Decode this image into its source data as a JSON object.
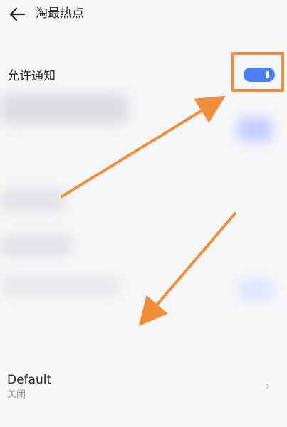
{
  "header": {
    "title": "淘最热点"
  },
  "notification": {
    "label": "允许通知",
    "enabled": true
  },
  "default": {
    "title": "Default",
    "status": "关闭"
  },
  "colors": {
    "accent": "#4f7df4",
    "highlight": "#f08e3b"
  },
  "icons": {
    "back": "back-arrow-icon",
    "chevron": "chevron-right-icon"
  }
}
